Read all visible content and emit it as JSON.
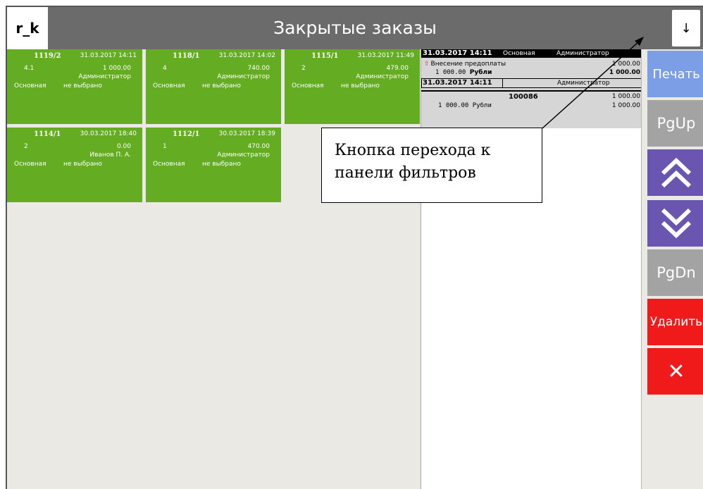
{
  "app": {
    "logo": "r_k",
    "title": "Закрытые заказы",
    "down_button": "↓"
  },
  "orders": [
    {
      "number": "1119/2",
      "datetime": "31.03.2017 14:11",
      "qty": "4.1",
      "amount": "1 000.00",
      "user": "Администратор",
      "hall": "Основная",
      "table": "не выбрано"
    },
    {
      "number": "1118/1",
      "datetime": "31.03.2017 14:02",
      "qty": "4",
      "amount": "740.00",
      "user": "Администратор",
      "hall": "Основная",
      "table": "не выбрано"
    },
    {
      "number": "1115/1",
      "datetime": "31.03.2017 11:49",
      "qty": "2",
      "amount": "479.00",
      "user": "Администратор",
      "hall": "Основная",
      "table": "не выбрано"
    },
    {
      "number": "1114/1",
      "datetime": "30.03.2017 18:40",
      "qty": "2",
      "amount": "0.00",
      "user": "Иванов П. А.",
      "hall": "Основная",
      "table": "не выбрано"
    },
    {
      "number": "1112/1",
      "datetime": "30.03.2017 18:39",
      "qty": "1",
      "amount": "470.00",
      "user": "Администратор",
      "hall": "Основная",
      "table": "не выбрано"
    }
  ],
  "receipt": {
    "header_datetime": "31.03.2017 14:11",
    "header_hall": "Основная",
    "header_user": "Администратор",
    "line_name": "Внесение предоплаты",
    "line_amount": "1 000.00",
    "line_sum": "1 000.00",
    "line_currency": "Рубли",
    "line_total": "1 000.00",
    "sub_datetime": "31.03.2017 14:11",
    "sub_user": "Администратор",
    "code": "100086",
    "code_amount": "1 000.00",
    "pay_amount": "1 000.00",
    "pay_currency": "Рубли",
    "pay_total": "1 000.00"
  },
  "callout": {
    "line1": "Кнопка перехода к",
    "line2": "панели фильтров"
  },
  "sidebar": {
    "print": "Печать",
    "pgup": "PgUp",
    "pgdn": "PgDn",
    "delete": "Удалить",
    "close": "✕"
  },
  "colors": {
    "card": "#64ad22",
    "header": "#6b6b6b",
    "print": "#7b9ee6",
    "nav": "#6a55b0",
    "page": "#a3a3a3",
    "danger": "#f01a1a"
  }
}
